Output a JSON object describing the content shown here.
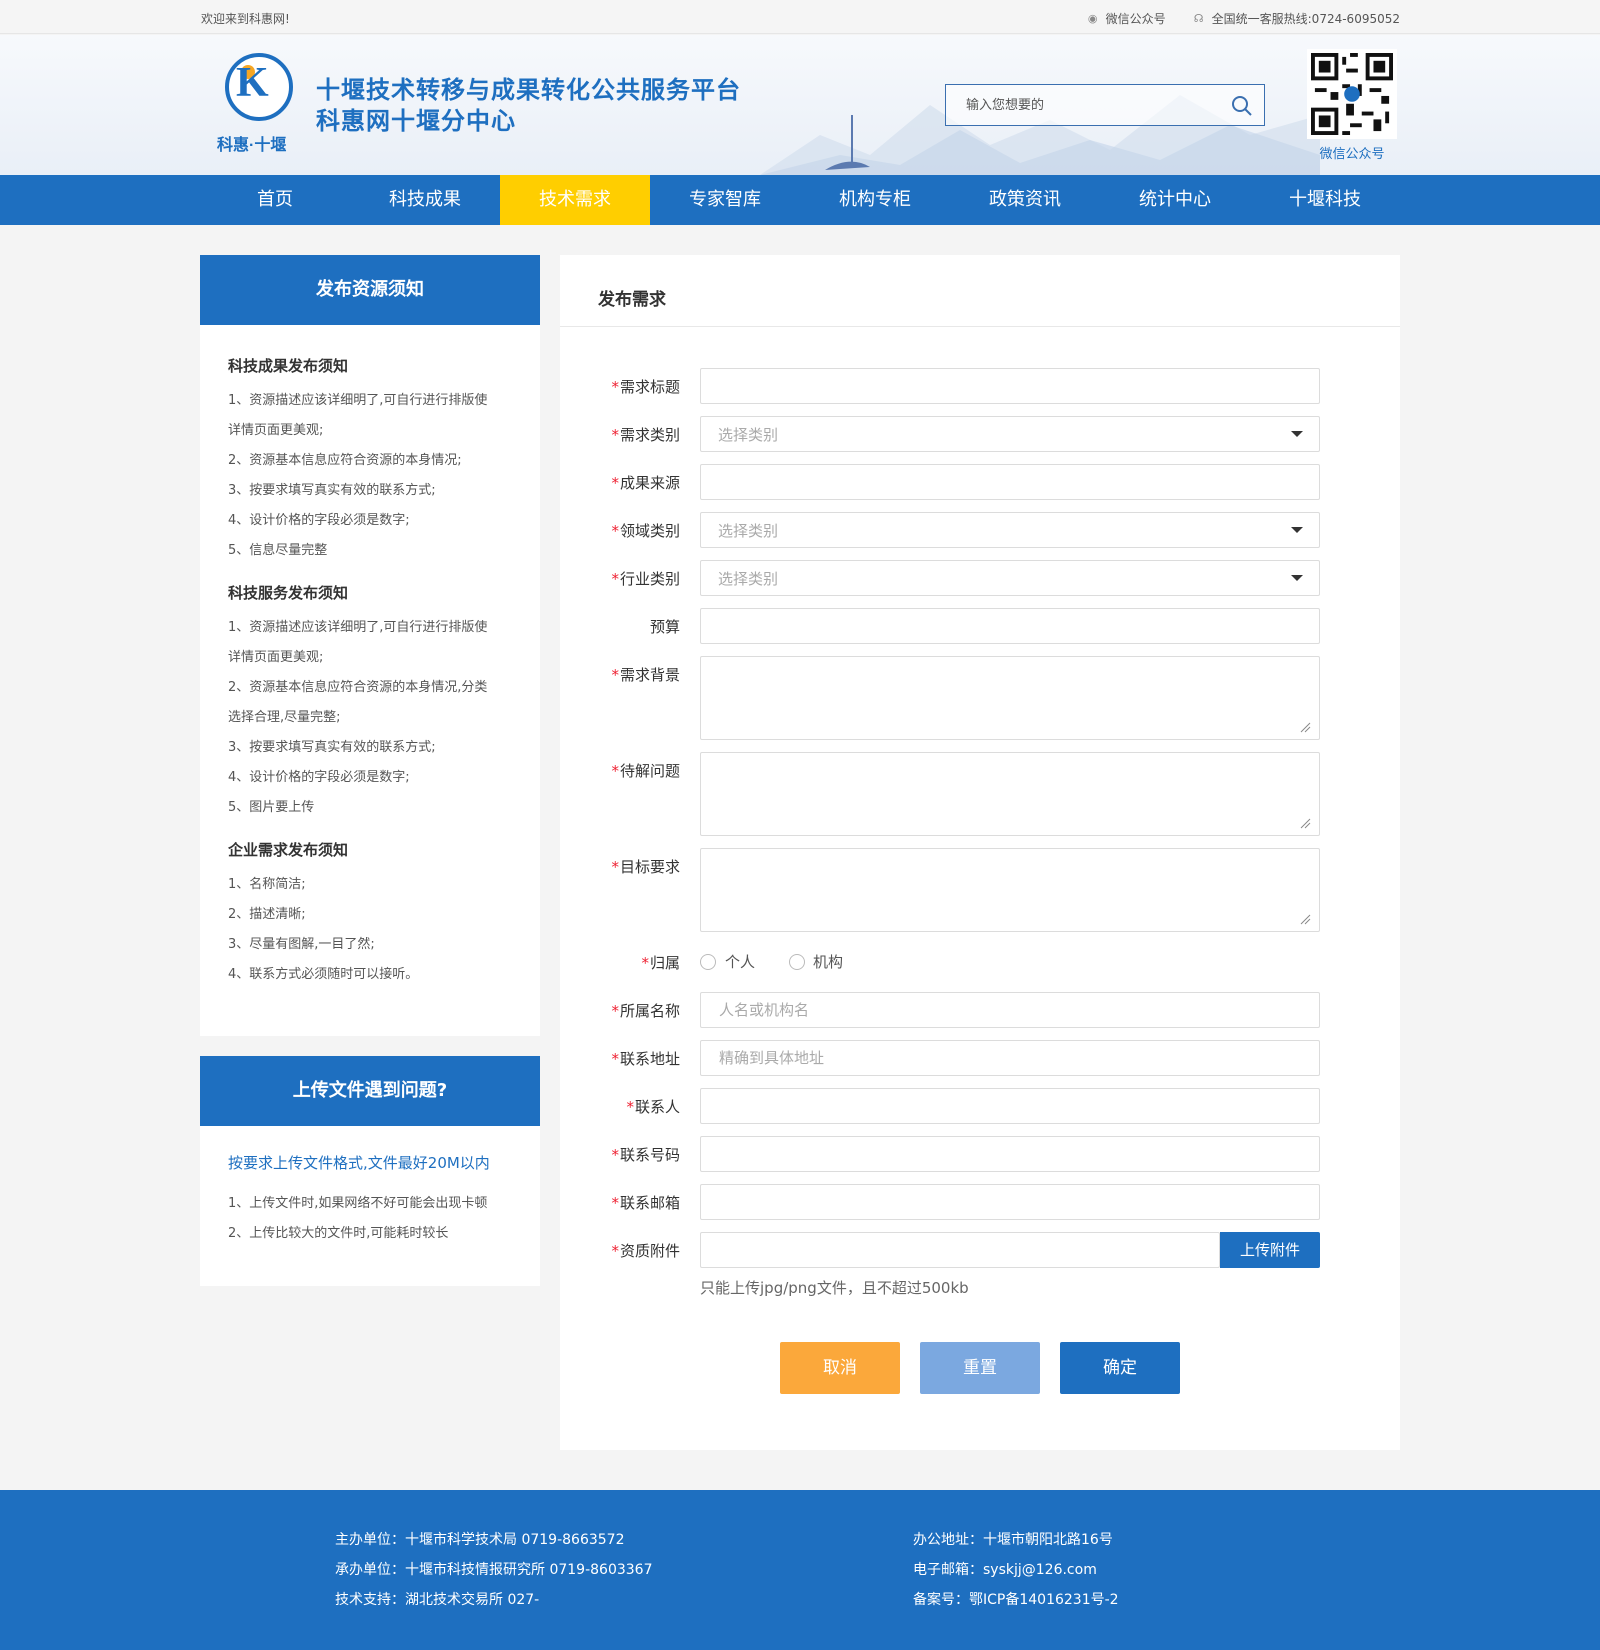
{
  "topbar": {
    "welcome": "欢迎来到科惠网!",
    "wechat": "微信公众号",
    "hotline": "全国统一客服热线:0724-6095052"
  },
  "header": {
    "logo_text": "科惠·十堰",
    "title_line1": "十堰技术转移与成果转化公共服务平台",
    "title_line2": "科惠网十堰分中心",
    "search_placeholder": "输入您想要的",
    "qr_caption": "微信公众号"
  },
  "nav": {
    "items": [
      "首页",
      "科技成果",
      "技术需求",
      "专家智库",
      "机构专柜",
      "政策资讯",
      "统计中心",
      "十堰科技"
    ],
    "active_index": 2
  },
  "sidebar": {
    "notice_title": "发布资源须知",
    "sections": [
      {
        "title": "科技成果发布须知",
        "items": [
          "1、资源描述应该详细明了,可自行进行排版使",
          "详情页面更美观;",
          "2、资源基本信息应符合资源的本身情况;",
          "3、按要求填写真实有效的联系方式;",
          "4、设计价格的字段必须是数字;",
          "5、信息尽量完整"
        ]
      },
      {
        "title": "科技服务发布须知",
        "items": [
          "1、资源描述应该详细明了,可自行进行排版使",
          "详情页面更美观;",
          "2、资源基本信息应符合资源的本身情况,分类",
          "选择合理,尽量完整;",
          "3、按要求填写真实有效的联系方式;",
          "4、设计价格的字段必须是数字;",
          "5、图片要上传"
        ]
      },
      {
        "title": "企业需求发布须知",
        "items": [
          "1、名称简洁;",
          "2、描述清晰;",
          "3、尽量有图解,一目了然;",
          "4、联系方式必须随时可以接听。"
        ]
      }
    ],
    "upload_title": "上传文件遇到问题?",
    "upload_link": "按要求上传文件格式,文件最好20M以内",
    "upload_items": [
      "1、上传文件时,如果网络不好可能会出现卡顿",
      "2、上传比较大的文件时,可能耗时较长"
    ]
  },
  "form": {
    "title": "发布需求",
    "required_mark": "*",
    "fields": {
      "demand_title": "需求标题",
      "demand_type": "需求类别",
      "source": "成果来源",
      "domain": "领域类别",
      "industry": "行业类别",
      "budget": "预算",
      "background": "需求背景",
      "problem": "待解问题",
      "goal": "目标要求",
      "belong": "归属",
      "belong_name": "所属名称",
      "address": "联系地址",
      "contact": "联系人",
      "phone": "联系号码",
      "email": "联系邮箱",
      "attachment": "资质附件"
    },
    "select_placeholder": "选择类别",
    "belong_options": [
      "个人",
      "机构"
    ],
    "belong_name_placeholder": "人名或机构名",
    "address_placeholder": "精确到具体地址",
    "upload_button": "上传附件",
    "upload_hint": "只能上传jpg/png文件，且不超过500kb",
    "buttons": {
      "cancel": "取消",
      "reset": "重置",
      "confirm": "确定"
    }
  },
  "footer": {
    "host": "主办单位：十堰市科学技术局   0719-8663572",
    "organizer": "承办单位：十堰市科技情报研究所   0719-8603367",
    "support": "技术支持：湖北技术交易所   027-",
    "office": "办公地址：十堰市朝阳北路16号",
    "email": "电子邮箱：syskjj@126.com",
    "icp": "备案号：鄂ICP备14016231号-2"
  },
  "colors": {
    "brand_blue": "#1e6fc0",
    "nav_active": "#ffce00",
    "cancel": "#fba83b",
    "reset": "#7ba8e0",
    "confirm": "#1e6fc0"
  }
}
